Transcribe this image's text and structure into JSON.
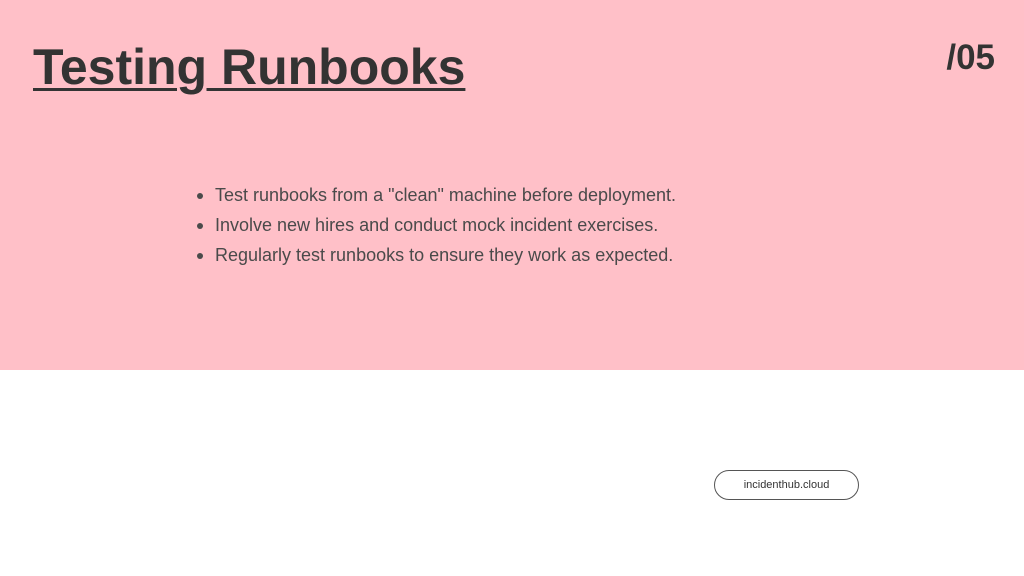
{
  "slide": {
    "title": "Testing Runbooks",
    "page_number": "/05",
    "bullets": [
      "Test runbooks from a \"clean\" machine before deployment.",
      "Involve new hires and conduct mock incident exercises.",
      "Regularly test runbooks to ensure they work as expected."
    ],
    "footer_url": "incidenthub.cloud"
  },
  "colors": {
    "panel_background": "#ffc0c8",
    "text_dark": "#333333",
    "text_body": "#4a4a4a"
  }
}
